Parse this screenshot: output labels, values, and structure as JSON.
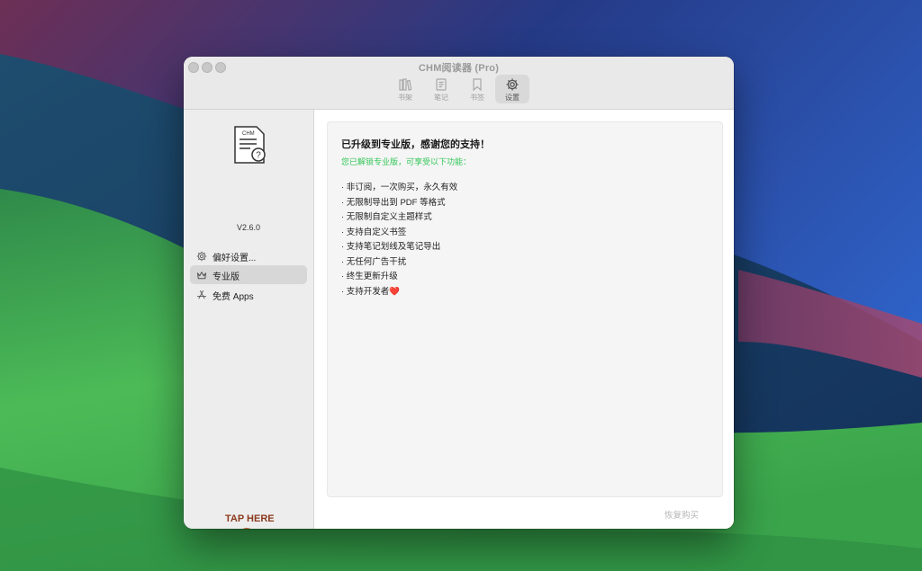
{
  "window": {
    "title": "CHM阅读器 (Pro)"
  },
  "toolbar": {
    "items": [
      {
        "label": "书架",
        "icon": "books-icon"
      },
      {
        "label": "笔记",
        "icon": "notes-icon"
      },
      {
        "label": "书签",
        "icon": "bookmark-icon"
      },
      {
        "label": "设置",
        "icon": "gear-icon",
        "selected": true
      }
    ]
  },
  "sidebar": {
    "app_icon_text": "CHM",
    "version": "V2.6.0",
    "items": [
      {
        "label": "偏好设置...",
        "icon": "gear-icon"
      },
      {
        "label": "专业版",
        "icon": "crown-icon",
        "selected": true
      },
      {
        "label": "免费 Apps",
        "icon": "app-store-icon"
      }
    ],
    "mascot_text": "TAP HERE"
  },
  "pro": {
    "heading": "已升级到专业版，感谢您的支持！",
    "subheading": "您已解锁专业版，可享受以下功能：",
    "features": [
      "· 非订阅，一次购买，永久有效",
      "· 无限制导出到 PDF 等格式",
      "· 无限制自定义主题样式",
      "· 支持自定义书签",
      "· 支持笔记划线及笔记导出",
      "· 无任何广告干扰",
      "· 终生更新升级",
      "· 支持开发者❤️"
    ],
    "restore_label": "恢复购买"
  },
  "colors": {
    "accent_green": "#34c759",
    "selected_bg": "#d7d7d7"
  }
}
